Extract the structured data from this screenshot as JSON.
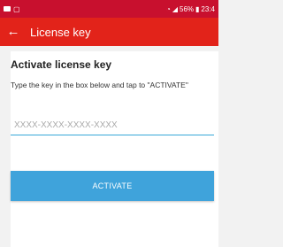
{
  "status_bar": {
    "battery": "56%",
    "time": "23:4"
  },
  "app_bar": {
    "back_icon": "arrow-left",
    "title": "License key"
  },
  "main": {
    "heading": "Activate license key",
    "instructions": "Type the key in the box below and tap to \"ACTIVATE\"",
    "key_input": {
      "value": "",
      "placeholder": "XXXX-XXXX-XXXX-XXXX"
    },
    "activate_label": "ACTIVATE"
  },
  "colors": {
    "app_bar": "#e2231a",
    "status_bar": "#c8102e",
    "accent": "#3fa3db"
  }
}
